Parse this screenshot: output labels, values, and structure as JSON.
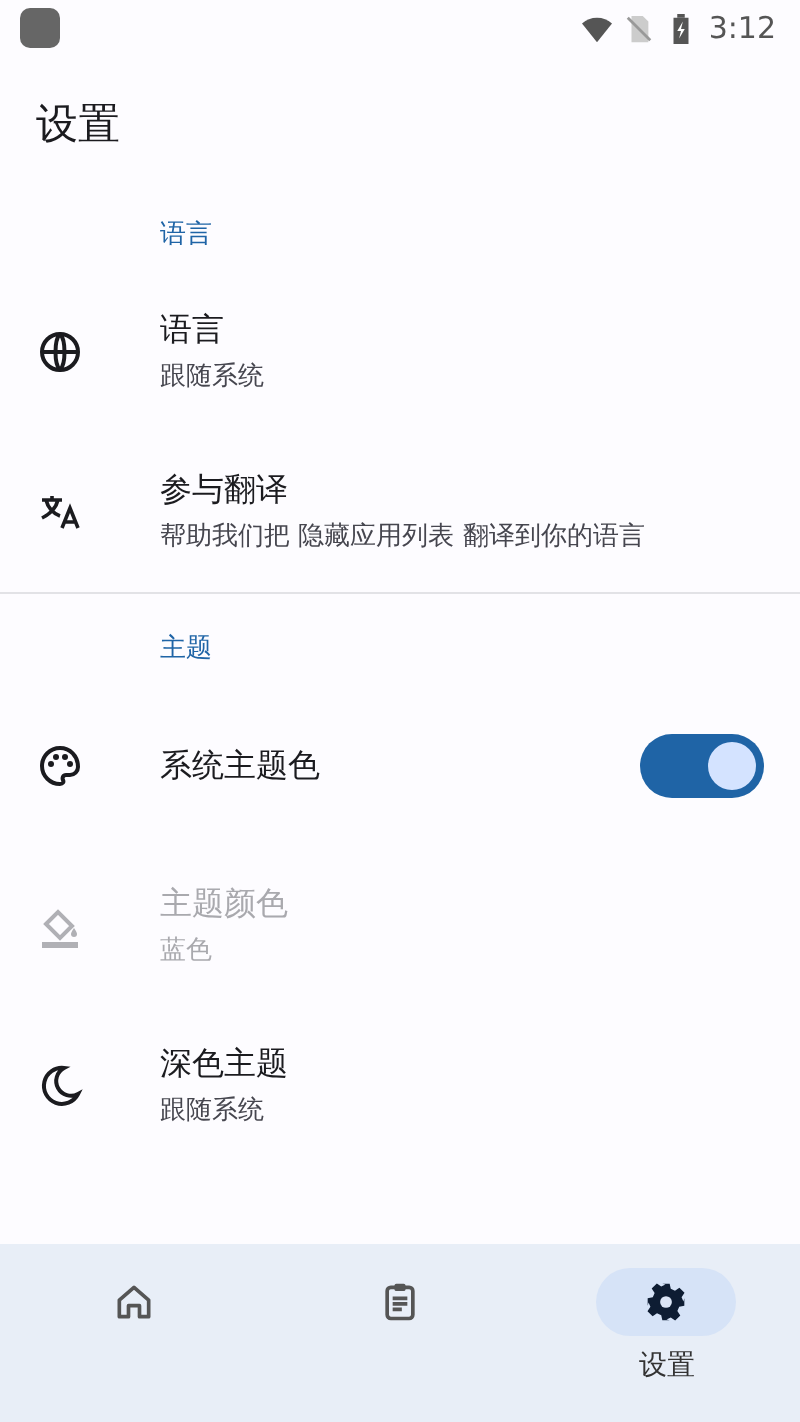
{
  "status_bar": {
    "time": "3:12"
  },
  "title": "设置",
  "sections": [
    {
      "header": "语言",
      "items": [
        {
          "kind": "plain",
          "title": "语言",
          "subtitle": "跟随系统",
          "disabled": false
        },
        {
          "kind": "plain",
          "title": "参与翻译",
          "subtitle": "帮助我们把 隐藏应用列表 翻译到你的语言",
          "disabled": false
        }
      ]
    },
    {
      "header": "主题",
      "items": [
        {
          "kind": "switch",
          "title": "系统主题色",
          "on": true,
          "disabled": false
        },
        {
          "kind": "plain",
          "title": "主题颜色",
          "subtitle": "蓝色",
          "disabled": true
        },
        {
          "kind": "plain",
          "title": "深色主题",
          "subtitle": "跟随系统",
          "disabled": false
        }
      ]
    }
  ],
  "nav": [
    {
      "selected": false
    },
    {
      "selected": false
    },
    {
      "label": "设置",
      "selected": true
    }
  ]
}
